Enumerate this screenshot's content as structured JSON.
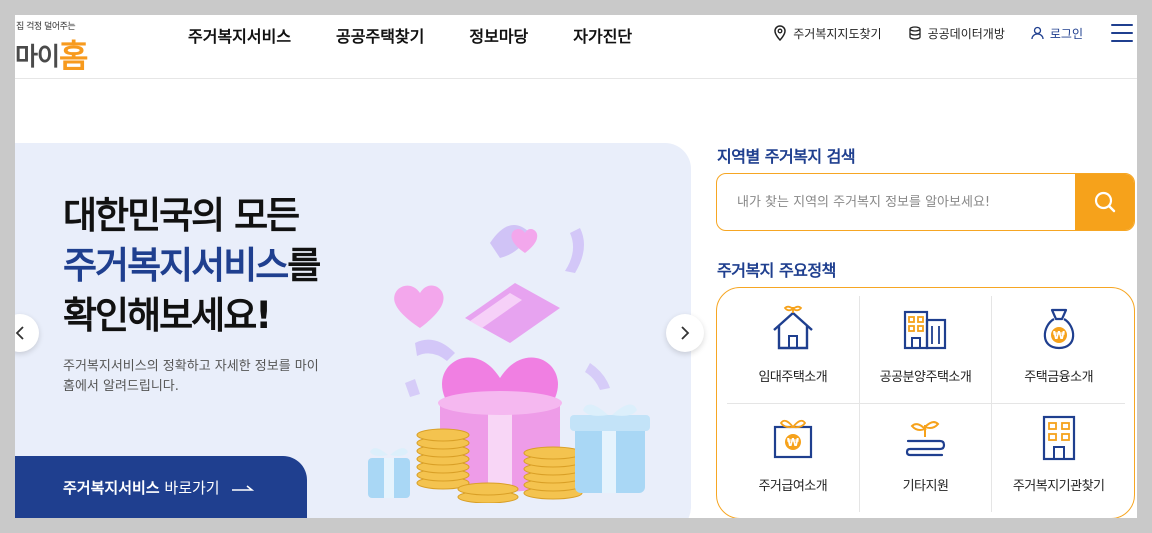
{
  "logo": {
    "tagline": "집 걱정 덜어주는",
    "name_part": "마이",
    "name_home": "홈"
  },
  "gnb": [
    {
      "label": "주거복지서비스"
    },
    {
      "label": "공공주택찾기"
    },
    {
      "label": "정보마당"
    },
    {
      "label": "자가진단"
    }
  ],
  "util": {
    "map_label": "주거복지지도찾기",
    "data_label": "공공데이터개방",
    "login_label": "로그인"
  },
  "banner": {
    "title_line1": "대한민국의 모든",
    "title_highlight": "주거복지서비스",
    "title_particle": "를",
    "title_line3": "확인해보세요!",
    "desc": "주거복지서비스의 정확하고 자세한 정보를 마이홈에서 알려드립니다.",
    "cta_bold": "주거복지서비스",
    "cta_rest": "바로가기"
  },
  "search": {
    "title": "지역별 주거복지 검색",
    "placeholder": "내가 찾는 지역의 주거복지 정보를 알아보세요!"
  },
  "policy": {
    "title": "주거복지 주요정책",
    "items": [
      {
        "label": "임대주택소개",
        "icon": "house-sprout-icon"
      },
      {
        "label": "공공분양주택소개",
        "icon": "apartment-buildings-icon"
      },
      {
        "label": "주택금융소개",
        "icon": "money-bag-icon"
      },
      {
        "label": "주거급여소개",
        "icon": "gift-won-icon"
      },
      {
        "label": "기타지원",
        "icon": "sprout-hand-icon"
      },
      {
        "label": "주거복지기관찾기",
        "icon": "office-building-icon"
      }
    ]
  },
  "colors": {
    "navy": "#1f3f8f",
    "orange": "#f6a21b",
    "banner_bg": "#e9eefa"
  }
}
